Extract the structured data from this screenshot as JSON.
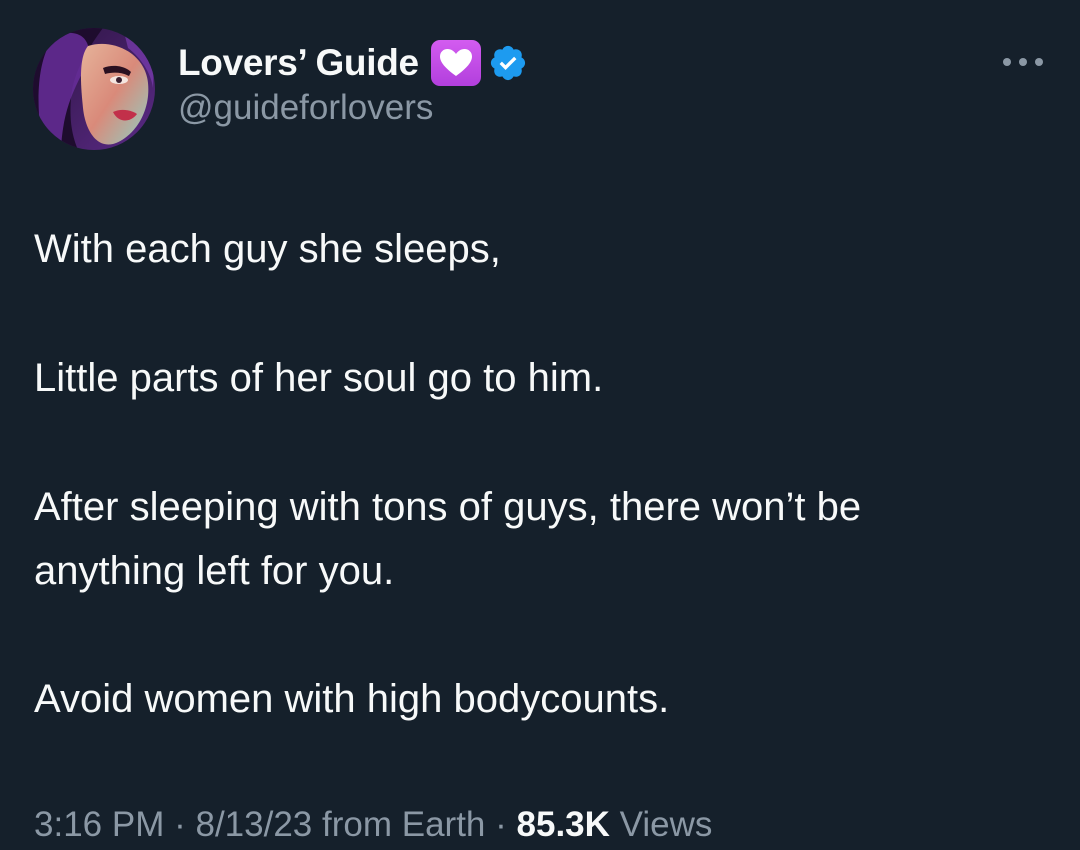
{
  "author": {
    "display_name": "Lovers’ Guide",
    "handle": "@guideforlovers",
    "badge_icon": "purple-heart-icon",
    "verified_icon": "verified-badge-icon",
    "verified_color": "#1d9bf0"
  },
  "tweet": {
    "lines": [
      "With each guy she sleeps,",
      "Little parts of her soul go to him.",
      "After sleeping with tons of guys, there won’t be",
      "anything left for you.",
      "Avoid women with high bodycounts."
    ]
  },
  "meta": {
    "time": "3:16 PM",
    "date": "8/13/23",
    "source": "from Earth",
    "sep": "·",
    "views_count": "85.3K",
    "views_label": "Views"
  },
  "colors": {
    "background": "#15202b",
    "text": "#f7f9f9",
    "secondary": "#8b98a5"
  }
}
